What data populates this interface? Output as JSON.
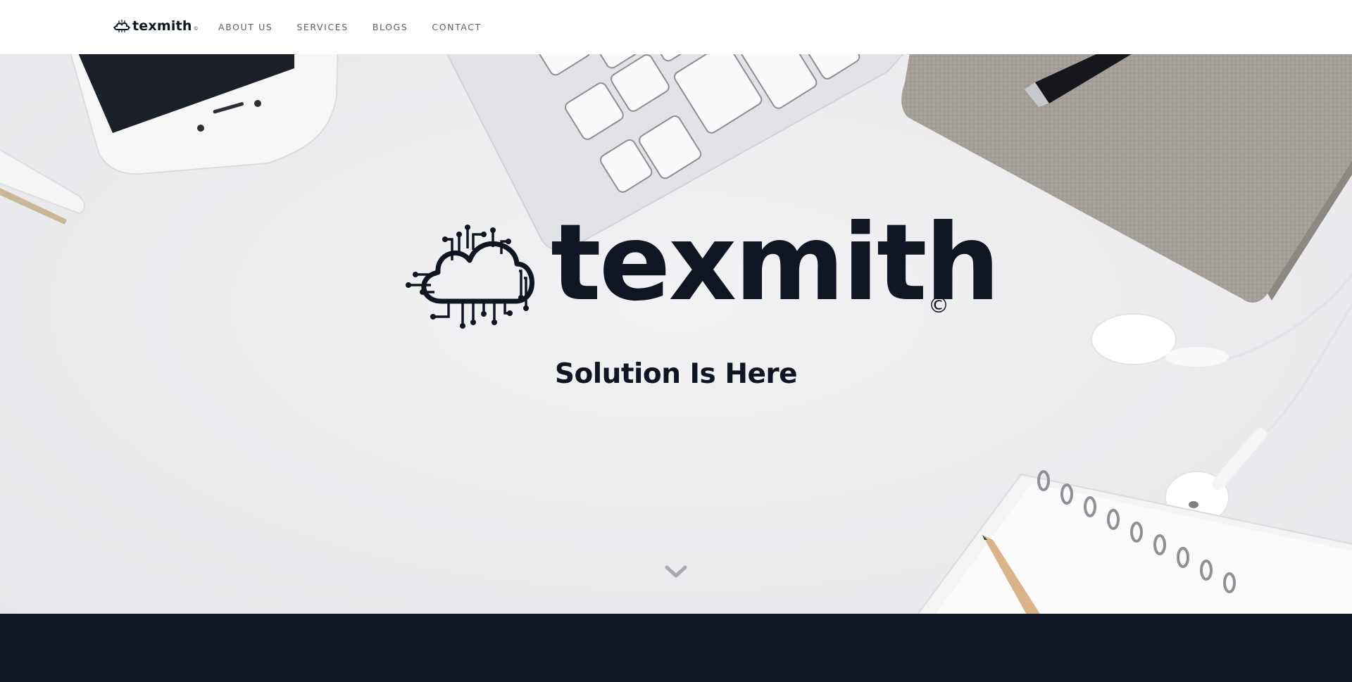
{
  "brand": {
    "name": "texmith",
    "registered_mark": "©"
  },
  "nav": {
    "items": [
      {
        "label": "ABOUT US"
      },
      {
        "label": "SERVICES"
      },
      {
        "label": "BLOGS"
      },
      {
        "label": "CONTACT"
      }
    ]
  },
  "hero": {
    "wordmark": "texmith",
    "copyright_mark": "©",
    "tagline": "Solution Is Here",
    "scroll_icon": "chevron-down-icon"
  },
  "colors": {
    "brand_dark": "#0f1522",
    "nav_text": "#5a5f6a",
    "hero_bg": "#ececef"
  }
}
